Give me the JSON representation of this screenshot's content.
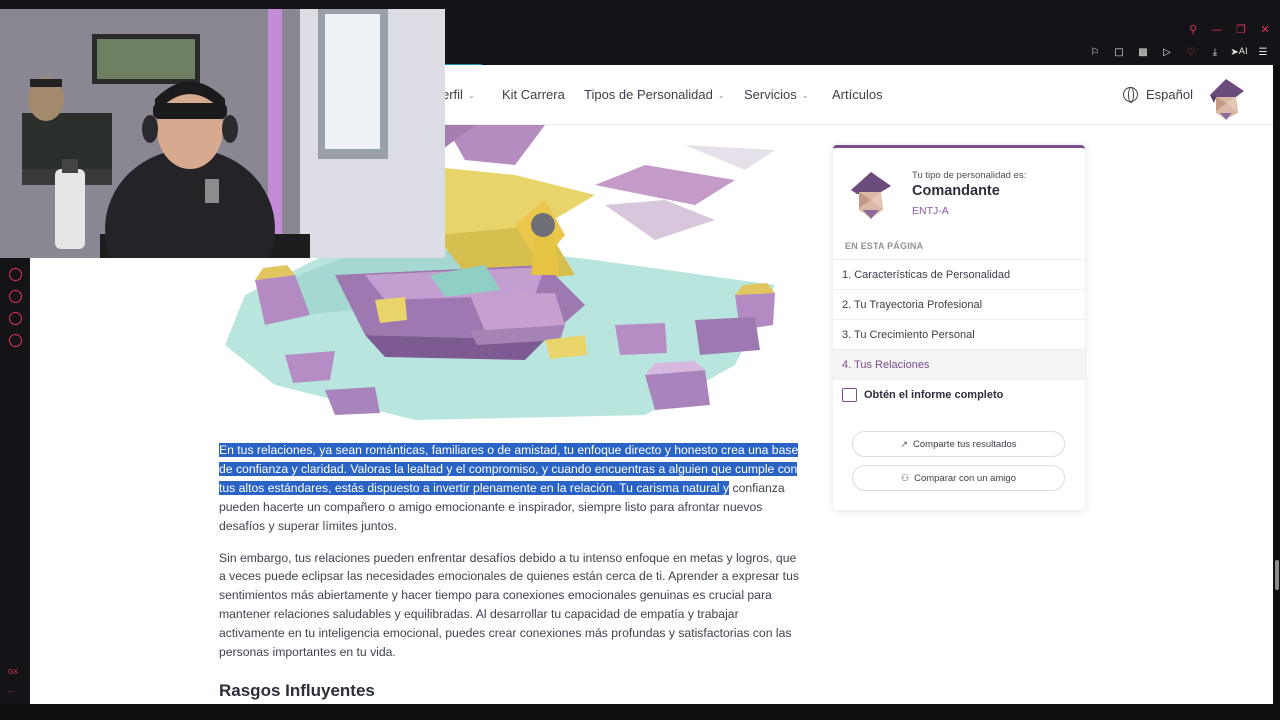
{
  "nav": {
    "items": [
      "erfil",
      "Kit Carrera",
      "Tipos de Personalidad",
      "Servicios",
      "Artículos"
    ],
    "language": "Español"
  },
  "browser": {
    "ai_label": "AI"
  },
  "sidebar_left": {
    "bottom_label": "GX"
  },
  "article": {
    "p1_highlighted": "En tus relaciones, ya sean románticas, familiares o de amistad, tu enfoque directo y honesto crea una base de confianza y claridad. Valoras la lealtad y el compromiso, y cuando encuentras a alguien que cumple con tus altos estándares, estás dispuesto a invertir plenamente en la relación. Tu carisma natural y",
    "p1_rest": " confianza pueden hacerte un compañero o amigo emocionante e inspirador, siempre listo para afrontar nuevos desafíos y superar límites juntos.",
    "p2": "Sin embargo, tus relaciones pueden enfrentar desafíos debido a tu intenso enfoque en metas y logros, que a veces puede eclipsar las necesidades emocionales de quienes están cerca de ti. Aprender a expresar tus sentimientos más abiertamente y hacer tiempo para conexiones emocionales genuinas es crucial para mantener relaciones saludables y equilibradas. Al desarrollar tu capacidad de empatía y trabajar activamente en tu inteligencia emocional, puedes crear conexiones más profundas y satisfactorias con las personas importantes en tu vida.",
    "heading": "Rasgos Influyentes"
  },
  "card": {
    "label": "Tu tipo de personalidad es:",
    "type": "Comandante",
    "code": "ENTJ-A",
    "section": "EN ESTA PÁGINA",
    "toc": [
      "1. Características de Personalidad",
      "2. Tu Trayectoria Profesional",
      "3. Tu Crecimiento Personal",
      "4. Tus Relaciones"
    ],
    "report": "Obtén el informe completo",
    "share_button": "Comparte tus resultados",
    "compare_button": "Comparar con un amigo"
  },
  "colors": {
    "accent_purple": "#7a4e8c",
    "selection_blue": "#2a63c6",
    "browser_accent": "#e2325a"
  }
}
